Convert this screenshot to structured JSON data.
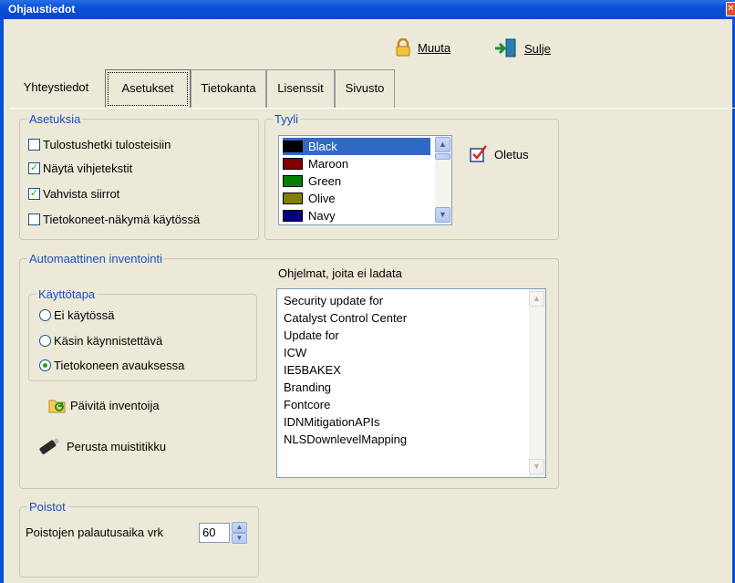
{
  "window": {
    "title": "Ohjaustiedot"
  },
  "toolbar": {
    "muuta_label": "Muuta",
    "sulje_label": "Sulje"
  },
  "tabs": [
    {
      "label": "Yhteystiedot"
    },
    {
      "label": "Asetukset",
      "active": true
    },
    {
      "label": "Tietokanta"
    },
    {
      "label": "Lisenssit"
    },
    {
      "label": "Sivusto"
    }
  ],
  "asetuksia": {
    "legend": "Asetuksia",
    "options": [
      {
        "label": "Tulostushetki tulosteisiin",
        "checked": false
      },
      {
        "label": "Näytä vihjetekstit",
        "checked": true
      },
      {
        "label": "Vahvista siirrot",
        "checked": true
      },
      {
        "label": "Tietokoneet-näkymä käytössä",
        "checked": false
      }
    ]
  },
  "tyyli": {
    "legend": "Tyyli",
    "colors": [
      {
        "name": "Black",
        "hex": "#000000",
        "selected": true
      },
      {
        "name": "Maroon",
        "hex": "#800000"
      },
      {
        "name": "Green",
        "hex": "#008000"
      },
      {
        "name": "Olive",
        "hex": "#808000"
      },
      {
        "name": "Navy",
        "hex": "#000080"
      }
    ],
    "default_button": "Oletus"
  },
  "inventointi": {
    "legend": "Automaattinen inventointi",
    "kayttotapa_legend": "Käyttötapa",
    "modes": [
      {
        "label": "Ei käytössä",
        "selected": false
      },
      {
        "label": "Käsin käynnistettävä",
        "selected": false
      },
      {
        "label": "Tietokoneen avauksessa",
        "selected": true
      }
    ],
    "update_button": "Päivitä inventoija",
    "usb_button": "Perusta muistitikku",
    "programs_label": "Ohjelmat, joita ei ladata",
    "programs": [
      "Security update for",
      "Catalyst Control Center",
      "Update for",
      "ICW",
      "IE5BAKEX",
      "Branding",
      "Fontcore",
      "IDNMitigationAPIs",
      "NLSDownlevelMapping"
    ]
  },
  "poistot": {
    "legend": "Poistot",
    "label": "Poistojen palautusaika vrk",
    "value": "60"
  },
  "colors": {
    "titlebar": "#0a4fd8",
    "legend": "#1d4fbf",
    "selection": "#316ac5",
    "check": "#21a121"
  }
}
